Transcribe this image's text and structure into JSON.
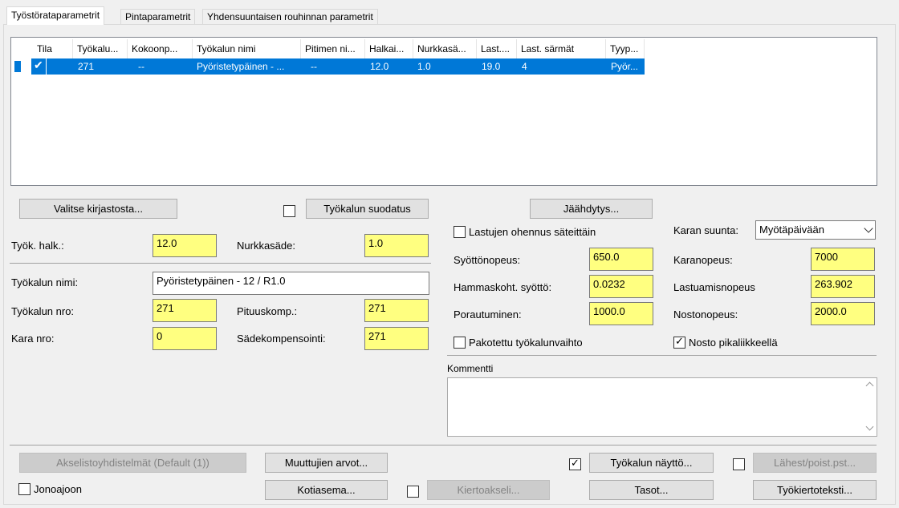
{
  "tabs": [
    "Työstörataparametrit",
    "Pintaparametrit",
    "Yhdensuuntaisen rouhinnan parametrit"
  ],
  "table": {
    "headers": [
      "Tila",
      "Työkalu...",
      "Kokoonp...",
      "Työkalun nimi",
      "Pitimen ni...",
      "Halkai...",
      "Nurkkasä...",
      "Last....",
      "Last. särmät",
      "Tyyp..."
    ],
    "row": [
      "271",
      "--",
      "Pyöristetypäinen - ...",
      "--",
      "12.0",
      "1.0",
      "19.0",
      "4",
      "Pyör..."
    ]
  },
  "buttons": {
    "library": "Valitse kirjastosta...",
    "filter": "Työkalun suodatus",
    "coolant": "Jäähdytys...",
    "axis_combo": "Akselistoyhdistelmät (Default (1))",
    "variables": "Muuttujien arvot...",
    "tool_display": "Työkalun näyttö...",
    "approach": "Lähest/poist.pst...",
    "home": "Kotiasema...",
    "rotary": "Kiertoakseli...",
    "planes": "Tasot...",
    "canned_text": "Työkiertoteksti..."
  },
  "fields": {
    "tool_dia_label": "Työk. halk.:",
    "tool_dia": "12.0",
    "corner_label": "Nurkkasäde:",
    "corner": "1.0",
    "tool_name_label": "Työkalun nimi:",
    "tool_name": "Pyöristetypäinen - 12 / R1.0",
    "tool_no_label": "Työkalun nro:",
    "tool_no": "271",
    "length_comp_label": "Pituuskomp.:",
    "length_comp": "271",
    "spindle_no_label": "Kara nro:",
    "spindle_no": "0",
    "radius_comp_label": "Sädekompensointi:",
    "radius_comp": "271",
    "chip_thin_label": "Lastujen ohennus säteittäin",
    "spindle_dir_label": "Karan suunta:",
    "spindle_dir": "Myötäpäivään",
    "feed_label": "Syöttönopeus:",
    "feed": "650.0",
    "spindle_speed_label": "Karanopeus:",
    "spindle_speed": "7000",
    "tooth_feed_label": "Hammaskoht. syöttö:",
    "tooth_feed": "0.0232",
    "chip_load_label": "Lastuamisnopeus",
    "chip_load": "263.902",
    "plunge_label": "Porautuminen:",
    "plunge": "1000.0",
    "retract_label": "Nostonopeus:",
    "retract": "2000.0",
    "force_change_label": "Pakotettu työkalunvaihto",
    "rapid_retract_label": "Nosto pikaliikkeellä",
    "comment_label": "Kommentti",
    "batch_label": "Jonoajoon"
  },
  "colors": {
    "selection": "#0078d7",
    "field": "#ffff80"
  }
}
